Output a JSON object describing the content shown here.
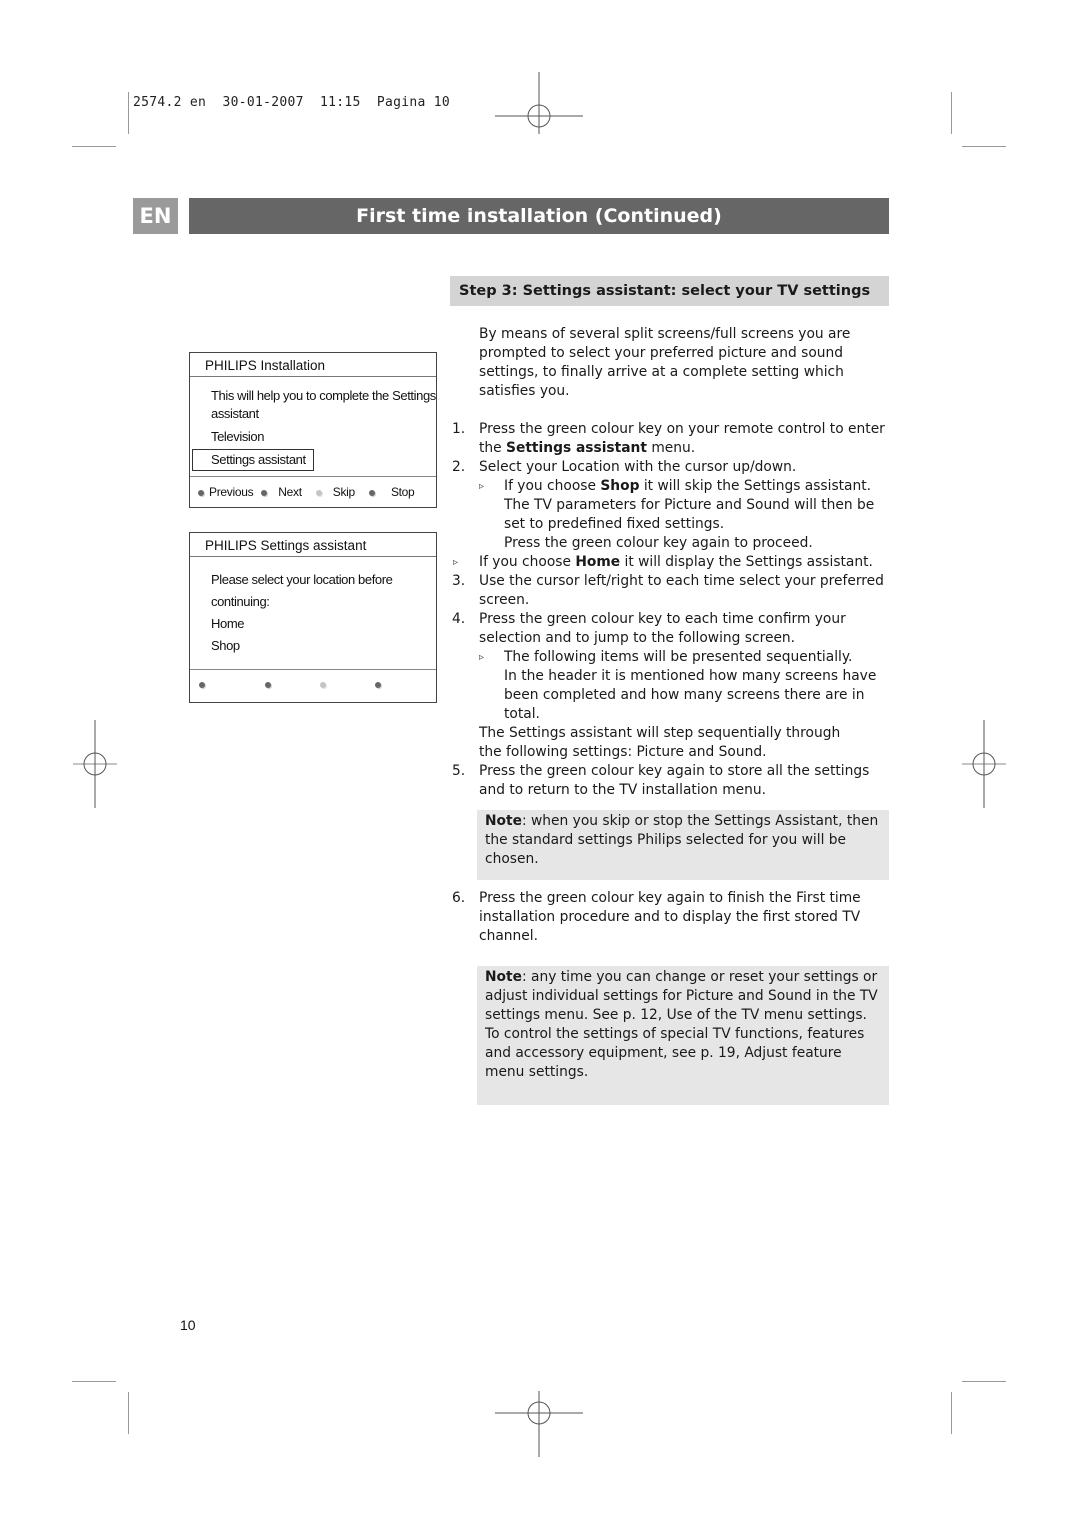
{
  "slug": {
    "doc_id": "2574.2",
    "lang": "en",
    "date": "30-01-2007",
    "time": "11:15",
    "page_label": "Pagina 10"
  },
  "header": {
    "lang_badge": "EN",
    "title": "First time installation  (Continued)"
  },
  "step": {
    "heading": "Step 3: Settings assistant: select your TV settings"
  },
  "tv_menu_1": {
    "header": "PHILIPS  Installation",
    "lines": [
      "This will help you to complete the Settings",
      "assistant",
      "Television"
    ],
    "selected_item": "Settings assistant",
    "footer": [
      {
        "label": "Previous",
        "icon": "red-key-dot"
      },
      {
        "label": "Next",
        "icon": "green-key-dot"
      },
      {
        "label": "Skip",
        "icon": "yellow-key-dot"
      },
      {
        "label": "Stop",
        "icon": "blue-key-dot"
      }
    ]
  },
  "tv_menu_2": {
    "header": "PHILIPS  Settings assistant",
    "lines": [
      "Please select your location before",
      "continuing:",
      "Home",
      "Shop"
    ],
    "footer_icons": [
      "red-key-dot",
      "green-key-dot",
      "yellow-key-dot",
      "blue-key-dot"
    ]
  },
  "content": {
    "intro": "By means of several split screens/full screens you are prompted to select your preferred picture and sound settings, to finally arrive at a complete setting which satisfies you.",
    "item1": {
      "num": "1.",
      "pre": "Press the green colour key on your remote control to enter the ",
      "bold": "Settings assistant",
      "post": " menu."
    },
    "item2": {
      "num": "2.",
      "text": "Select your Location with the cursor up/down."
    },
    "item2_sub1": {
      "pre": "If you choose ",
      "bold": "Shop",
      "post": " it will skip the Settings assistant. The TV parameters for Picture and Sound will then be set to predefined fixed settings."
    },
    "item2_sub1_cont": "Press the green colour key again to proceed.",
    "item2_sub2": {
      "pre": "If you choose ",
      "bold": "Home",
      "post": " it will display the Settings assistant."
    },
    "item3": {
      "num": "3.",
      "text": "Use the cursor left/right to each time select your preferred screen."
    },
    "item4": {
      "num": "4.",
      "text": "Press the green colour key to each time confirm your selection and to jump to the following screen."
    },
    "item4_sub1": "The following items will be presented sequentially.",
    "item4_sub1_cont": "In the header it is mentioned how many screens have been completed and how many screens there are in total.",
    "item4_after": "The Settings assistant will step sequentially through the following settings: Picture and Sound.",
    "item5": {
      "num": "5.",
      "text": "Press the green colour key again to store all the settings and to return to the TV installation menu."
    },
    "note1": {
      "label": "Note",
      "text": ": when you skip or stop the Settings Assistant, then the standard settings Philips selected for you will be chosen."
    },
    "item6": {
      "num": "6.",
      "text": "Press the green colour key again to finish the First time installation procedure and to display the first stored TV channel."
    },
    "note2": {
      "label": "Note",
      "text": ": any time you can change or reset your settings or adjust individual settings for Picture and Sound in the TV settings menu. See p. 12, Use of the TV menu settings.",
      "text2": "To control the settings of special TV functions, features and accessory equipment, see p. 19,  Adjust feature menu settings."
    }
  },
  "page_number": "10",
  "triangle_glyph": "▹"
}
